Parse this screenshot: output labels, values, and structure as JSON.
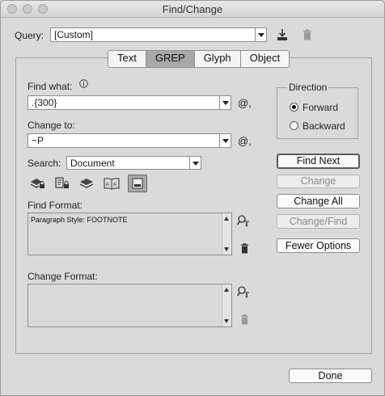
{
  "window": {
    "title": "Find/Change"
  },
  "query": {
    "label": "Query:",
    "value": "[Custom]"
  },
  "tabs": [
    {
      "label": "Text",
      "active": false
    },
    {
      "label": "GREP",
      "active": true
    },
    {
      "label": "Glyph",
      "active": false
    },
    {
      "label": "Object",
      "active": false
    }
  ],
  "find": {
    "label": "Find what:",
    "value": ".{300}"
  },
  "change": {
    "label": "Change to:",
    "value": "~P"
  },
  "search": {
    "label": "Search:",
    "value": "Document"
  },
  "find_format": {
    "label": "Find Format:",
    "value": "Paragraph Style: FOOTNOTE"
  },
  "change_format": {
    "label": "Change Format:",
    "value": ""
  },
  "direction": {
    "label": "Direction",
    "options": [
      {
        "label": "Forward",
        "selected": true
      },
      {
        "label": "Backward",
        "selected": false
      }
    ]
  },
  "buttons": {
    "find_next": "Find Next",
    "change": "Change",
    "change_all": "Change All",
    "change_find": "Change/Find",
    "fewer_options": "Fewer Options",
    "done": "Done"
  },
  "icons": {
    "special_char": "@,",
    "text_aa": "A A"
  }
}
